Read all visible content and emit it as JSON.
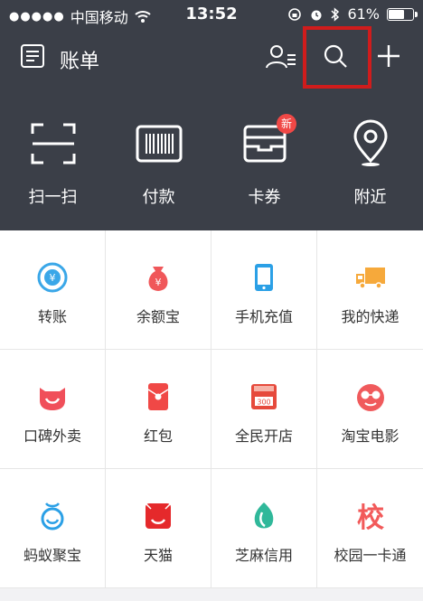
{
  "status_bar": {
    "signal": "●●●●●",
    "carrier": "中国移动",
    "time": "13:52",
    "battery": "61%"
  },
  "header": {
    "title": "账单"
  },
  "quick_actions": [
    {
      "label": "扫一扫",
      "icon": "scan-icon"
    },
    {
      "label": "付款",
      "icon": "barcode-icon"
    },
    {
      "label": "卡券",
      "icon": "wallet-icon"
    },
    {
      "label": "附近",
      "icon": "location-pin-icon"
    }
  ],
  "card_badge": "新",
  "services": [
    {
      "label": "转账",
      "icon": "transfer-icon",
      "color": "#3aa7e8"
    },
    {
      "label": "余额宝",
      "icon": "money-bag-icon",
      "color": "#f0575a"
    },
    {
      "label": "手机充值",
      "icon": "phone-icon",
      "color": "#2ba0e6"
    },
    {
      "label": "我的快递",
      "icon": "truck-icon",
      "color": "#f6a93b"
    },
    {
      "label": "口碑外卖",
      "icon": "smile-icon",
      "color": "#f04f5a"
    },
    {
      "label": "红包",
      "icon": "red-packet-icon",
      "color": "#f04846"
    },
    {
      "label": "全民开店",
      "icon": "store-icon",
      "color": "#e64a3c"
    },
    {
      "label": "淘宝电影",
      "icon": "movie-face-icon",
      "color": "#f05a5c"
    },
    {
      "label": "蚂蚁聚宝",
      "icon": "ant-icon",
      "color": "#2ba0e6"
    },
    {
      "label": "天猫",
      "icon": "tmall-icon",
      "color": "#e5292b"
    },
    {
      "label": "芝麻信用",
      "icon": "sesame-icon",
      "color": "#30b89a"
    },
    {
      "label": "校园一卡通",
      "icon": "campus-icon",
      "icon_text": "校",
      "color": "#f25a5a"
    }
  ]
}
